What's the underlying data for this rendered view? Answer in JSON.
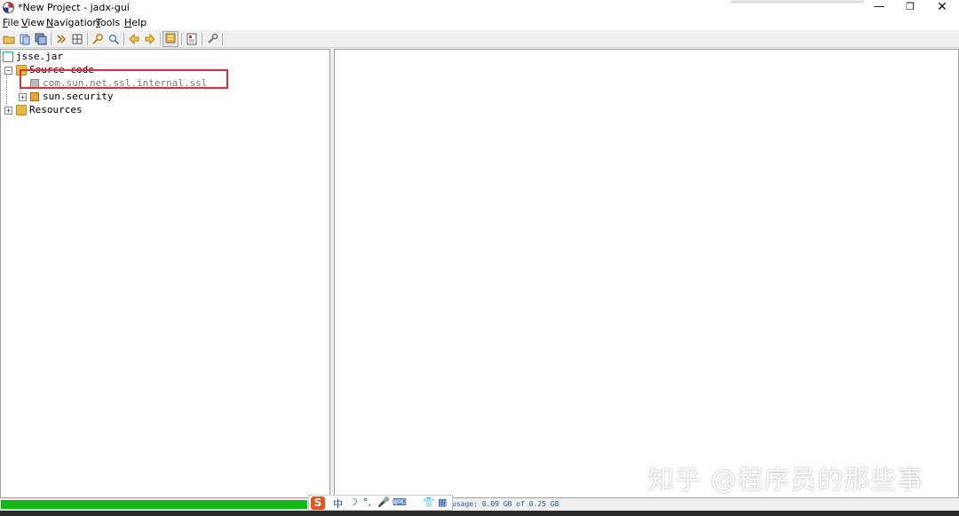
{
  "window": {
    "title": "*New Project - jadx-gui",
    "min_glyph": "—",
    "max_glyph": "❐",
    "close_glyph": "✕"
  },
  "menu": [
    {
      "label_u": "F",
      "label_rest": "ile"
    },
    {
      "label_u": "V",
      "label_rest": "iew"
    },
    {
      "label_u": "N",
      "label_rest": "avigation"
    },
    {
      "label_u": "T",
      "label_rest": "ools"
    },
    {
      "label_u": "H",
      "label_rest": "elp"
    }
  ],
  "toolbar": {
    "icons": [
      "open-folder-icon",
      "add-files-icon",
      "save-all-icon",
      "sync-icon",
      "flatten-icon",
      "search-icon",
      "find-icon",
      "back-icon",
      "forward-icon",
      "deobfuscation-icon",
      "log-icon",
      "preferences-icon"
    ]
  },
  "tree": {
    "root": "jsse.jar",
    "source_code": "Source code",
    "pkg_internal": "com.sun.net.ssl.internal.ssl",
    "pkg_security": "sun.security",
    "resources": "Resources",
    "expand_minus": "−",
    "expand_plus": "+"
  },
  "status": {
    "memory": "usage: 0.09 GB of 0.25 GB",
    "progress": 1.0
  },
  "ime": {
    "logo": "S",
    "items": [
      "中",
      "☽",
      "°,",
      "🎤",
      "⌨",
      "👕",
      "▦"
    ]
  },
  "watermark": "知乎 @程序员的那些事",
  "colors": {
    "progress": "#12b912",
    "highlight": "#e03030"
  }
}
